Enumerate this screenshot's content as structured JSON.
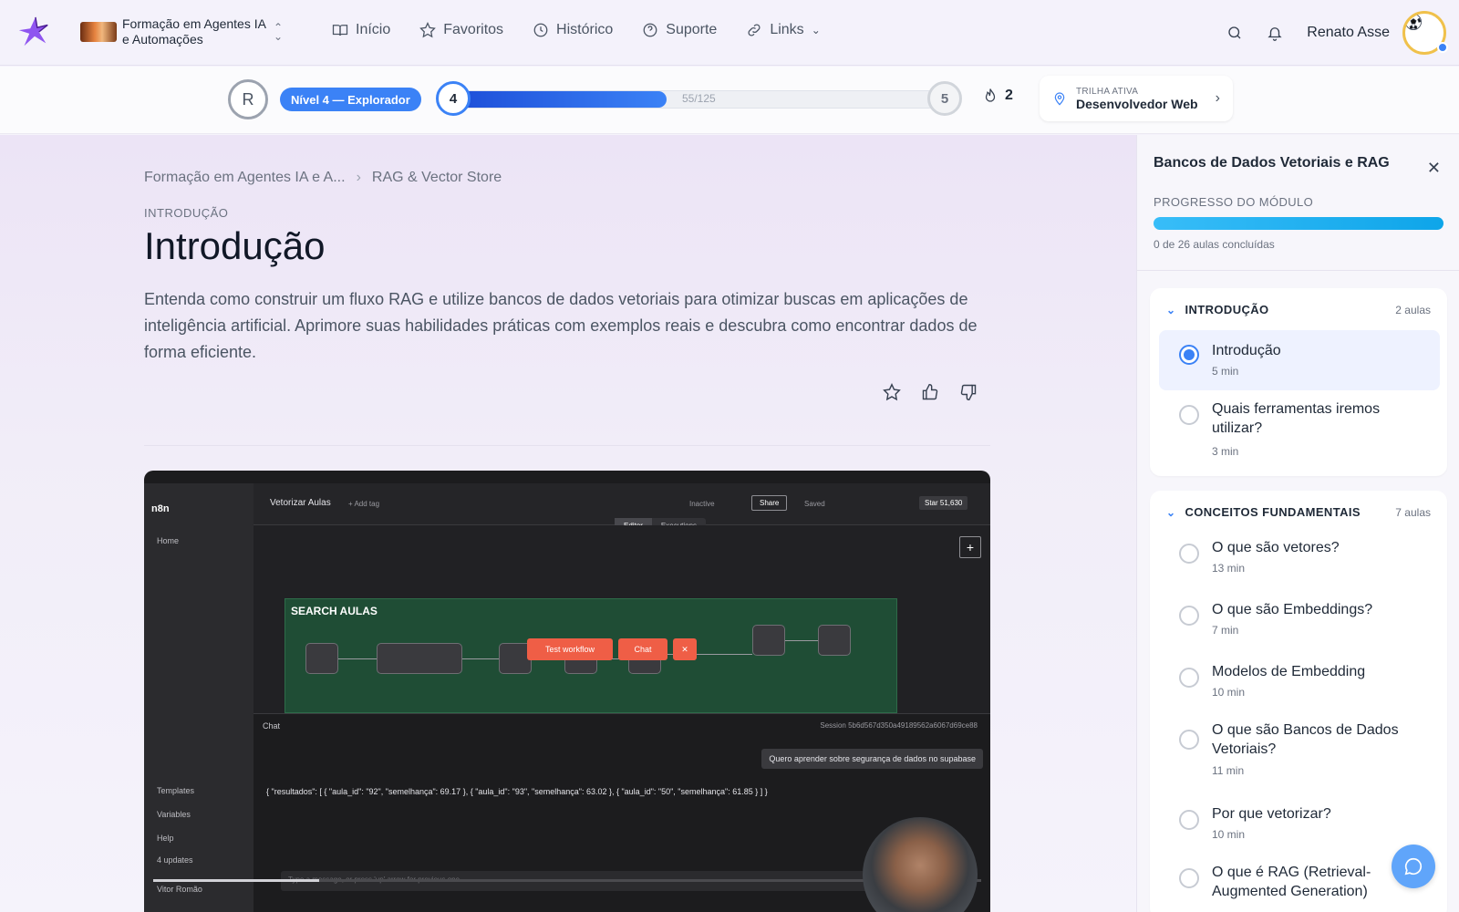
{
  "nav": {
    "course_title": "Formação em Agentes IA e Automações",
    "menu": [
      {
        "label": "Início",
        "icon": "book-icon"
      },
      {
        "label": "Favoritos",
        "icon": "star-icon"
      },
      {
        "label": "Histórico",
        "icon": "clock-icon"
      },
      {
        "label": "Suporte",
        "icon": "help-circle-icon"
      },
      {
        "label": "Links",
        "icon": "link-icon"
      }
    ],
    "user_name": "Renato Asse"
  },
  "xp": {
    "user_initial": "R",
    "level_badge": "Nível 4 — Explorador",
    "current_level": "4",
    "next_level": "5",
    "xp_text": "55/125",
    "progress_fraction": 0.44,
    "streak": "2",
    "trail_label": "TRILHA ATIVA",
    "trail_value": "Desenvolvedor Web"
  },
  "main": {
    "breadcrumb": [
      "Formação em Agentes IA e A...",
      "RAG & Vector Store"
    ],
    "kicker": "INTRODUÇÃO",
    "title": "Introdução",
    "description": "Entenda como construir um fluxo RAG e utilize bancos de dados vetoriais para otimizar buscas em aplicações de inteligência artificial. Aprimore suas habilidades práticas com exemplos reais e descubra como encontrar dados de forma eficiente."
  },
  "video": {
    "brand": "n8n",
    "side_items": [
      "Home",
      "Templates",
      "Variables",
      "Help",
      "4 updates",
      "Vitor Romão"
    ],
    "workflow_name": "Vetorizar Aulas",
    "add_tag": "+ Add tag",
    "tabs": [
      "Editor",
      "Executions"
    ],
    "inactive": "Inactive",
    "share": "Share",
    "saved": "Saved",
    "star": "Star  51,630",
    "group_title": "SEARCH AULAS",
    "test_workflow": "Test workflow",
    "chat_btn": "Chat",
    "chat_label": "Chat",
    "session": "Session  5b6d567d350a49189562a6067d69ce88",
    "user_message": "Quero aprender sobre segurança de dados no supabase",
    "json_result": "{ \"resultados\": [ { \"aula_id\": \"92\", \"semelhança\": 69.17 }, { \"aula_id\": \"93\", \"semelhança\": 63.02 }, { \"aula_id\": \"50\", \"semelhança\": 61.85 } ] }",
    "input_placeholder": "Type a message, or press 'up' arrow for previous one",
    "played_fraction": 0.2
  },
  "sidebar": {
    "title": "Bancos de Dados Vetoriais e RAG",
    "progress_label": "PROGRESSO DO MÓDULO",
    "progress_fraction": 1.0,
    "progress_count": "0 de 26 aulas concluídas",
    "sections": [
      {
        "title": "INTRODUÇÃO",
        "count": "2 aulas",
        "lessons": [
          {
            "title": "Introdução",
            "duration": "5 min",
            "active": true
          },
          {
            "title": "Quais ferramentas iremos utilizar?",
            "duration": "3 min",
            "active": false
          }
        ]
      },
      {
        "title": "CONCEITOS FUNDAMENTAIS",
        "count": "7 aulas",
        "lessons": [
          {
            "title": "O que são vetores?",
            "duration": "13 min"
          },
          {
            "title": "O que são Embeddings?",
            "duration": "7 min"
          },
          {
            "title": "Modelos de Embedding",
            "duration": "10 min"
          },
          {
            "title": "O que são Bancos de Dados Vetoriais?",
            "duration": "11 min"
          },
          {
            "title": "Por que vetorizar?",
            "duration": "10 min"
          },
          {
            "title": "O que é RAG (Retrieval-Augmented Generation)",
            "duration": ""
          }
        ]
      }
    ]
  },
  "colors": {
    "accent": "#3b82f6",
    "progress": "#0ea5e9",
    "workflow_btn": "#ef5e46"
  }
}
